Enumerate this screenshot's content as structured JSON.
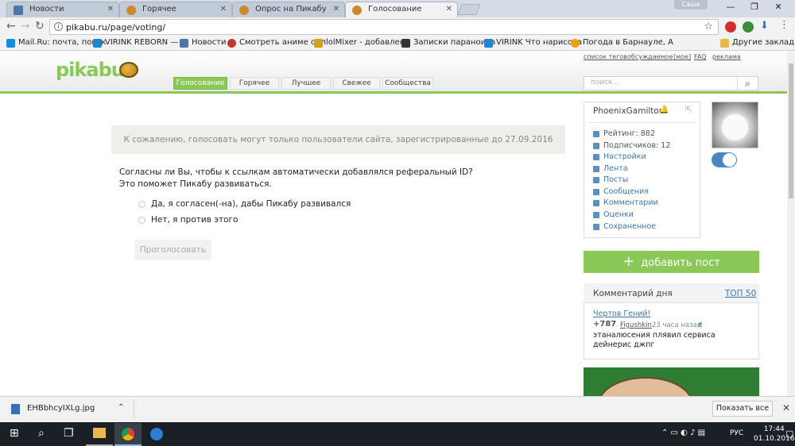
{
  "browser": {
    "tabs": [
      {
        "title": "Новости",
        "active": false,
        "color": "#4a76a8"
      },
      {
        "title": "Горячее",
        "active": false,
        "color": "#c88a2a"
      },
      {
        "title": "Опрос на Пикабу",
        "active": false,
        "color": "#c88a2a"
      },
      {
        "title": "Голосование",
        "active": true,
        "color": "#c88a2a"
      }
    ],
    "profile_name": "Саша",
    "url": "pikabu.ru/page/voting/",
    "bookmarks": [
      {
        "label": "Mail.Ru: почта, поиск",
        "color": "#168de2"
      },
      {
        "label": "VIRINK REBORN — н",
        "color": "#1a87d0"
      },
      {
        "label": "Новости",
        "color": "#4a76a8"
      },
      {
        "label": "Смотреть аниме онл",
        "color": "#c0392b"
      },
      {
        "label": "lolMixer - добавлени",
        "color": "#d4a017"
      },
      {
        "label": "Записки параноика",
        "color": "#333333"
      },
      {
        "label": "VIRINK Что нарисова",
        "color": "#1a87d0"
      },
      {
        "label": "Погода в Барнауле, А",
        "color": "#f39c12"
      }
    ],
    "other_bookmarks": "Другие закладки"
  },
  "site": {
    "logo": "pikabu",
    "top_links": [
      "список тегов",
      "обсуждаемое",
      "[мое]",
      "FAQ",
      "реклама"
    ],
    "nav_tabs": [
      "Голосование",
      "Горячее",
      "Лучшее",
      "Свежее",
      "Сообщества"
    ],
    "search_placeholder": "поиск...",
    "accent_color": "#8ac858"
  },
  "main": {
    "notice": "К сожалению, голосовать могут только пользователи сайта, зарегистрированные до 27.09.2016",
    "question_line1": "Согласны ли Вы, чтобы к ссылкам автоматически добавлялся реферальный ID?",
    "question_line2": "Это поможет Пикабу развиваться.",
    "options": [
      "Да, я согласен(-на), дабы Пикабу развивался",
      "Нет, я против этого"
    ],
    "vote_button": "Проголосовать"
  },
  "user": {
    "name": "PhoenixGamilton",
    "rating": "Рейтинг: 882",
    "subscribers": "Подписчиков: 12",
    "links": [
      "Настройки",
      "Лента",
      "Посты",
      "Сообщения",
      "Комментарии",
      "Оценки",
      "Сохраненное"
    ],
    "toggle_on": true
  },
  "sidebar": {
    "add_post": "добавить пост",
    "comment_of_day": "Комментарий дня",
    "top50": "ТОП 50",
    "post_title": "Чертов Гений!",
    "post_rating": "+787",
    "post_author": "Figushkin",
    "post_time": "23 часа назад",
    "post_hash": "#",
    "post_text": "этаналюсения плявил сервиса дейнерис джпг"
  },
  "downloads": {
    "file": "EHBbhcyIXLg.jpg",
    "show_all": "Показать все"
  },
  "taskbar": {
    "language": "РУС",
    "time": "17:44",
    "date": "01.10.2016"
  }
}
